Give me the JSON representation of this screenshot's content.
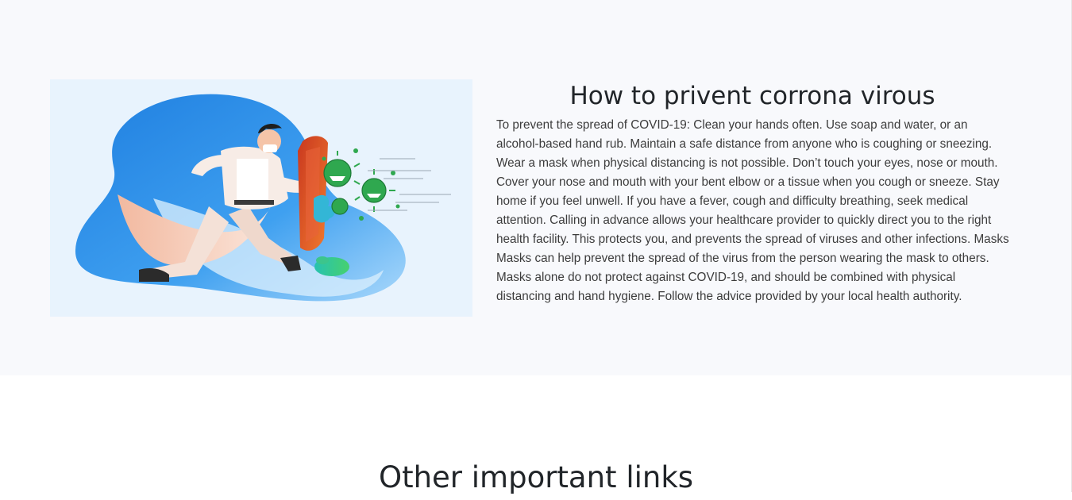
{
  "prevent_section": {
    "title": "How to privent corrona virous",
    "body": "To prevent the spread of COVID-19: Clean your hands often. Use soap and water, or an alcohol-based hand rub. Maintain a safe distance from anyone who is coughing or sneezing. Wear a mask when physical distancing is not possible. Don’t touch your eyes, nose or mouth. Cover your nose and mouth with your bent elbow or a tissue when you cough or sneeze. Stay home if you feel unwell. If you have a fever, cough and difficulty breathing, seek medical attention. Calling in advance allows your healthcare provider to quickly direct you to the right health facility. This protects you, and prevents the spread of viruses and other infections. Masks Masks can help prevent the spread of the virus from the person wearing the mask to others. Masks alone do not protect against COVID-19, and should be combined with physical distancing and hand hygiene. Follow the advice provided by your local health authority.",
    "illustration_icon": "doctor-shield-virus-illustration"
  },
  "links_section": {
    "title": "Other important links"
  },
  "colors": {
    "section_background": "#f8f9fc",
    "illustration_background": "#e8f3fd",
    "blob_blue": "#2f8ee5",
    "virus_green": "#2fa84f",
    "shield_red": "#d9452b"
  }
}
